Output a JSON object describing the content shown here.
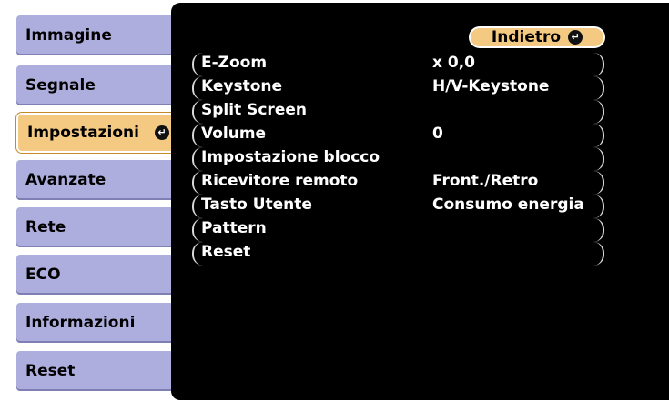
{
  "tabs": [
    {
      "label": "Immagine",
      "active": false
    },
    {
      "label": "Segnale",
      "active": false
    },
    {
      "label": "Impostazioni",
      "active": true
    },
    {
      "label": "Avanzate",
      "active": false
    },
    {
      "label": "Rete",
      "active": false
    },
    {
      "label": "ECO",
      "active": false
    },
    {
      "label": "Informazioni",
      "active": false
    },
    {
      "label": "Reset",
      "active": false
    }
  ],
  "back_button": {
    "label": "Indietro"
  },
  "menu": [
    {
      "label": "E-Zoom",
      "value": "x  0,0"
    },
    {
      "label": "Keystone",
      "value": "H/V-Keystone"
    },
    {
      "label": "Split Screen",
      "value": ""
    },
    {
      "label": "Volume",
      "value": "  0"
    },
    {
      "label": "Impostazione blocco",
      "value": ""
    },
    {
      "label": "Ricevitore remoto",
      "value": "Front./Retro"
    },
    {
      "label": "Tasto Utente",
      "value": "Consumo energia"
    },
    {
      "label": "Pattern",
      "value": ""
    },
    {
      "label": "Reset",
      "value": ""
    }
  ],
  "colors": {
    "tab_bg": "#aeaede",
    "tab_active_bg": "#f4c981",
    "panel_bg": "#000000",
    "text_on_panel": "#ffffff"
  }
}
